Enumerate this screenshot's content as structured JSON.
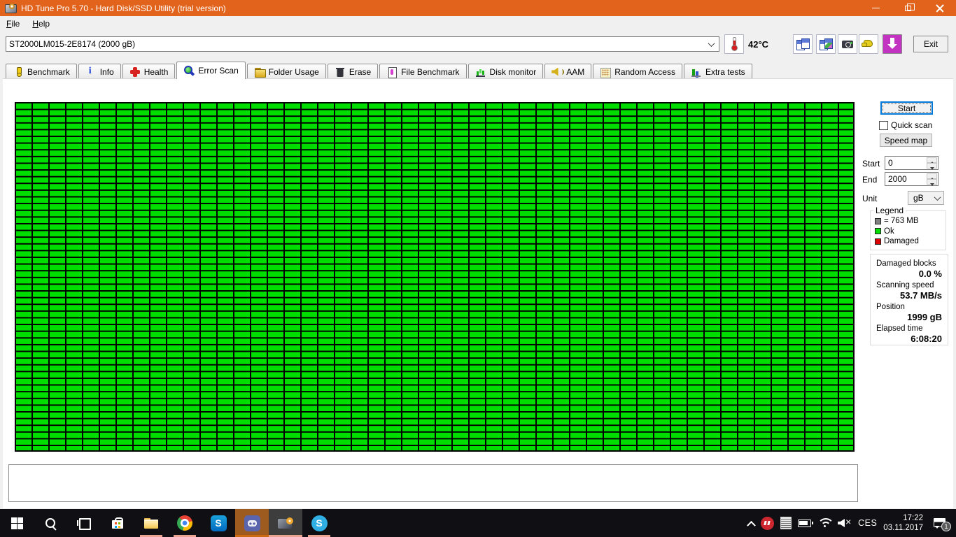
{
  "window": {
    "title": "HD Tune Pro 5.70 - Hard Disk/SSD Utility (trial version)",
    "titlebar_color": "#E2631C"
  },
  "menu": {
    "file": "File",
    "help": "Help"
  },
  "toolbar": {
    "drive_selector_value": "ST2000LM015-2E8174 (2000 gB)",
    "temperature": "42°C",
    "exit_label": "Exit"
  },
  "tabs": [
    {
      "label": "Benchmark"
    },
    {
      "label": "Info"
    },
    {
      "label": "Health"
    },
    {
      "label": "Error Scan",
      "active": true
    },
    {
      "label": "Folder Usage"
    },
    {
      "label": "Erase"
    },
    {
      "label": "File Benchmark"
    },
    {
      "label": "Disk monitor"
    },
    {
      "label": "AAM"
    },
    {
      "label": "Random Access"
    },
    {
      "label": "Extra tests"
    }
  ],
  "error_scan": {
    "grid": {
      "columns": 50,
      "rows": 52,
      "ok_color": "#00DE00",
      "line_color": "#000000",
      "all_blocks_status": "ok"
    },
    "controls": {
      "start_button": "Start",
      "quick_scan_label": "Quick scan",
      "quick_scan_checked": false,
      "speed_map_button": "Speed map",
      "start_label": "Start",
      "start_value": "0",
      "end_label": "End",
      "end_value": "2000",
      "unit_label": "Unit",
      "unit_value": "gB"
    },
    "legend": {
      "title": "Legend",
      "block_size_color": "#808080",
      "block_size_label": "= 763 MB",
      "ok_color": "#00DE00",
      "ok_label": "Ok",
      "damaged_color": "#DE0000",
      "damaged_label": "Damaged"
    },
    "stats": [
      {
        "label": "Damaged blocks",
        "value": "0.0 %"
      },
      {
        "label": "Scanning speed",
        "value": "53.7 MB/s"
      },
      {
        "label": "Position",
        "value": "1999 gB"
      },
      {
        "label": "Elapsed time",
        "value": "6:08:20"
      }
    ]
  },
  "taskbar": {
    "language": "CES",
    "clock": {
      "time": "17:22",
      "date": "03.11.2017"
    },
    "notification_badge": "1"
  }
}
